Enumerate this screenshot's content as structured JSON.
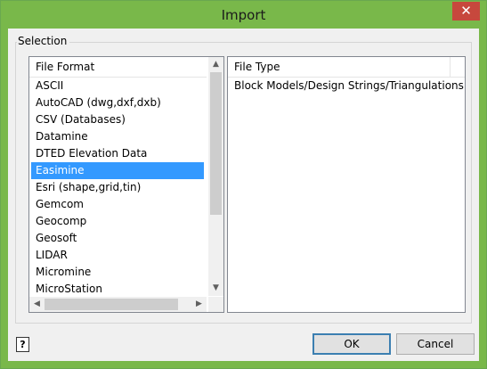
{
  "window": {
    "title": "Import",
    "close_label": "✕"
  },
  "selection": {
    "group_label": "Selection"
  },
  "file_format": {
    "header": "File Format",
    "items": [
      "ASCII",
      "AutoCAD (dwg,dxf,dxb)",
      "CSV (Databases)",
      "Datamine",
      "DTED Elevation Data",
      "Easimine",
      "Esri (shape,grid,tin)",
      "Gemcom",
      "Geocomp",
      "Geosoft",
      "LIDAR",
      "Micromine",
      "MicroStation"
    ],
    "selected": "Easimine"
  },
  "file_type": {
    "header": "File Type",
    "items": [
      "Block Models/Design Strings/Triangulations"
    ]
  },
  "buttons": {
    "ok": "OK",
    "cancel": "Cancel",
    "help": "?"
  },
  "icons": {
    "scroll_up": "▲",
    "scroll_down": "▼",
    "scroll_left": "◀",
    "scroll_right": "▶"
  }
}
